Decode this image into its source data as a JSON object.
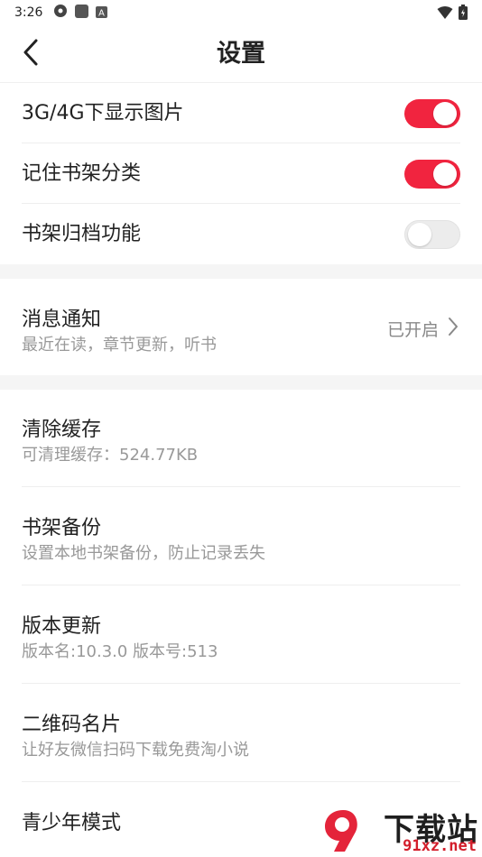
{
  "status_bar": {
    "time": "3:26",
    "left_icons": [
      "settings-gear-icon",
      "square-icon",
      "a-letter-icon"
    ],
    "right_icons": [
      "wifi-icon",
      "battery-icon"
    ]
  },
  "header": {
    "title": "设置",
    "back_icon": "chevron-left-icon"
  },
  "toggles": [
    {
      "label": "3G/4G下显示图片",
      "on": true
    },
    {
      "label": "记住书架分类",
      "on": true
    },
    {
      "label": "书架归档功能",
      "on": false
    }
  ],
  "notification": {
    "title": "消息通知",
    "subtitle": "最近在读，章节更新，听书",
    "value": "已开启"
  },
  "items": [
    {
      "title": "清除缓存",
      "subtitle": "可清理缓存：524.77KB"
    },
    {
      "title": "书架备份",
      "subtitle": "设置本地书架备份，防止记录丢失"
    },
    {
      "title": "版本更新",
      "subtitle": "版本名:10.3.0  版本号:513"
    },
    {
      "title": "二维码名片",
      "subtitle": "让好友微信扫码下载免费淘小说"
    },
    {
      "title": "青少年模式",
      "subtitle": ""
    }
  ],
  "watermark": {
    "logo_text": "下载站",
    "url": "91xz.net"
  },
  "colors": {
    "accent": "#f1243f",
    "switch_off": "#ececec",
    "secondary_text": "#999999"
  }
}
